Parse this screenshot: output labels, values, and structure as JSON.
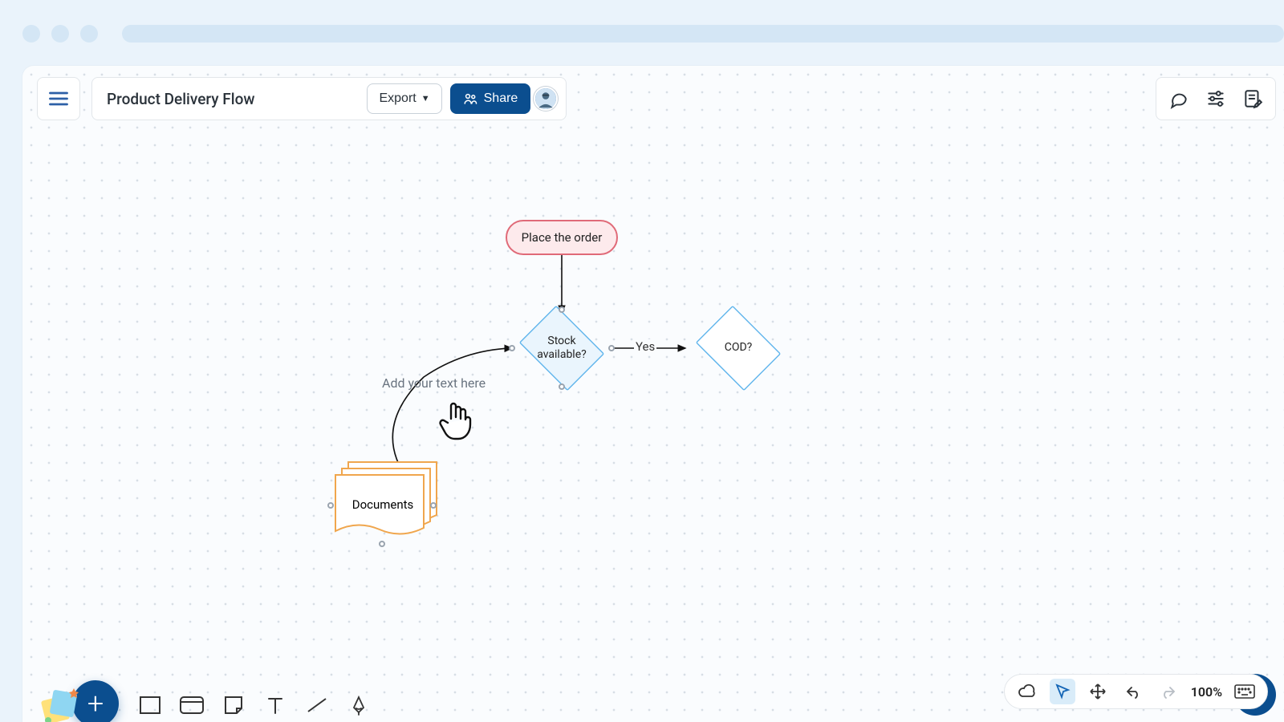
{
  "header": {
    "title": "Product Delivery Flow",
    "export_label": "Export",
    "share_label": "Share"
  },
  "right_tools": {
    "comment_icon": "comment-icon",
    "settings_icon": "sliders-icon",
    "notes_icon": "note-edit-icon"
  },
  "bottom_right": {
    "zoom_label": "100%"
  },
  "flow": {
    "start_label": "Place the order",
    "decision1_label": "Stock\navailable?",
    "edge_yes": "Yes",
    "decision2_label": "COD?",
    "documents_label": "Documents",
    "hint_label": "Add your text here"
  }
}
